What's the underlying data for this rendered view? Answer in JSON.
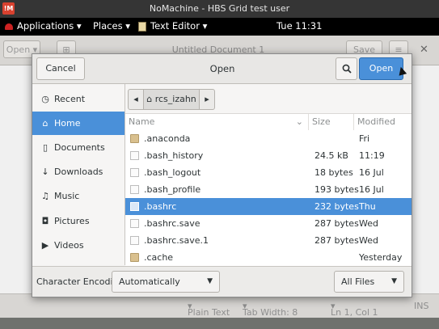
{
  "titlebar": {
    "logo": "!M",
    "title": "NoMachine - HBS Grid test user"
  },
  "panel": {
    "applications": "Applications",
    "places": "Places",
    "app_menu": "Text Editor",
    "clock": "Tue 11:31"
  },
  "gedit": {
    "open_label": "Open",
    "title": "Untitled Document 1",
    "save_label": "Save"
  },
  "statusbar": {
    "language": "Plain Text",
    "tab_width": "Tab Width: 8",
    "position": "Ln 1, Col 1",
    "mode": "INS"
  },
  "dialog": {
    "title": "Open",
    "cancel_label": "Cancel",
    "open_label": "Open",
    "sidebar": [
      {
        "label": "Recent",
        "icon": "clock-icon",
        "glyph": "◷"
      },
      {
        "label": "Home",
        "icon": "home-icon",
        "glyph": "⌂"
      },
      {
        "label": "Documents",
        "icon": "document-icon",
        "glyph": "▯"
      },
      {
        "label": "Downloads",
        "icon": "download-icon",
        "glyph": "↓"
      },
      {
        "label": "Music",
        "icon": "music-icon",
        "glyph": "♫"
      },
      {
        "label": "Pictures",
        "icon": "camera-icon",
        "glyph": "◘"
      },
      {
        "label": "Videos",
        "icon": "video-icon",
        "glyph": "▶"
      }
    ],
    "selected_sidebar": "Home",
    "path": {
      "current": "rcs_izahn"
    },
    "columns": {
      "name": "Name",
      "size": "Size",
      "modified": "Modified"
    },
    "files": [
      {
        "name": ".anaconda",
        "size": "",
        "modified": "Fri",
        "type": "folder"
      },
      {
        "name": ".bash_history",
        "size": "24.5 kB",
        "modified": "11:19",
        "type": "text"
      },
      {
        "name": ".bash_logout",
        "size": "18 bytes",
        "modified": "16 Jul",
        "type": "text"
      },
      {
        "name": ".bash_profile",
        "size": "193 bytes",
        "modified": "16 Jul",
        "type": "text"
      },
      {
        "name": ".bashrc",
        "size": "232 bytes",
        "modified": "Thu",
        "type": "text",
        "selected": true
      },
      {
        "name": ".bashrc.save",
        "size": "287 bytes",
        "modified": "Wed",
        "type": "text"
      },
      {
        "name": ".bashrc.save.1",
        "size": "287 bytes",
        "modified": "Wed",
        "type": "text"
      },
      {
        "name": ".cache",
        "size": "",
        "modified": "Yesterday",
        "type": "folder"
      }
    ],
    "encoding_label": "Character Encoding:",
    "encoding_value": "Automatically Detected",
    "filter_value": "All Files"
  },
  "colors": {
    "accent": "#4a90d9",
    "panel": "#000000"
  }
}
